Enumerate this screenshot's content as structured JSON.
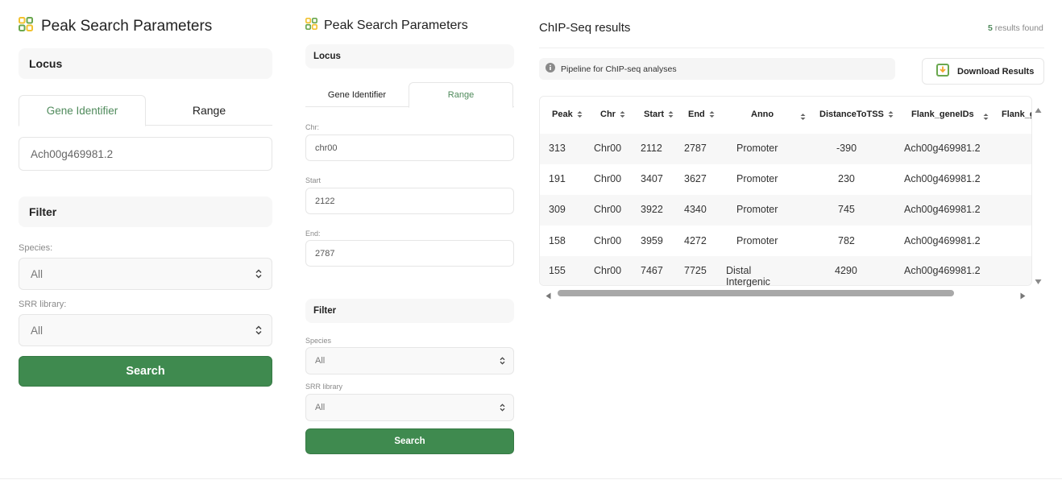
{
  "panel_left": {
    "title": "Peak Search Parameters",
    "locus_header": "Locus",
    "tabs": [
      {
        "label": "Gene Identifier",
        "active": true
      },
      {
        "label": "Range",
        "active": false
      }
    ],
    "gene_input_value": "Ach00g469981.2",
    "filter_header": "Filter",
    "species_label": "Species:",
    "species_value": "All",
    "srr_label": "SRR library:",
    "srr_value": "All",
    "search_label": "Search"
  },
  "panel_middle": {
    "title": "Peak Search Parameters",
    "locus_header": "Locus",
    "tabs": [
      {
        "label": "Gene Identifier",
        "active": false
      },
      {
        "label": "Range",
        "active": true
      }
    ],
    "chr_label": "Chr:",
    "chr_value": "chr00",
    "start_label": "Start",
    "start_value": "2122",
    "end_label": "End:",
    "end_value": "2787",
    "filter_header": "Filter",
    "species_label": "Species",
    "species_value": "All",
    "srr_label": "SRR library",
    "srr_value": "All",
    "search_label": "Search"
  },
  "results": {
    "title": "ChIP-Seq results",
    "count": "5",
    "count_suffix": "results found",
    "info_text": "Pipeline for ChIP-seq analyses",
    "download_label": "Download Results",
    "columns": [
      "Peak",
      "Chr",
      "Start",
      "End",
      "Anno",
      "DistanceToTSS",
      "Flank_geneIDs",
      "Flank_g"
    ],
    "rows": [
      [
        "313",
        "Chr00",
        "2112",
        "2787",
        "Promoter",
        "-390",
        "Ach00g469981.2"
      ],
      [
        "191",
        "Chr00",
        "3407",
        "3627",
        "Promoter",
        "230",
        "Ach00g469981.2"
      ],
      [
        "309",
        "Chr00",
        "3922",
        "4340",
        "Promoter",
        "745",
        "Ach00g469981.2"
      ],
      [
        "158",
        "Chr00",
        "3959",
        "4272",
        "Promoter",
        "782",
        "Ach00g469981.2"
      ],
      [
        "155",
        "Chr00",
        "7467",
        "7725",
        "Distal Intergenic",
        "4290",
        "Ach00g469981.2"
      ]
    ]
  },
  "colors": {
    "accent_green": "#3f8a4f",
    "tab_green": "#4f8a5b",
    "icon_green": "#6aa84f",
    "icon_yellow": "#f2c230"
  }
}
